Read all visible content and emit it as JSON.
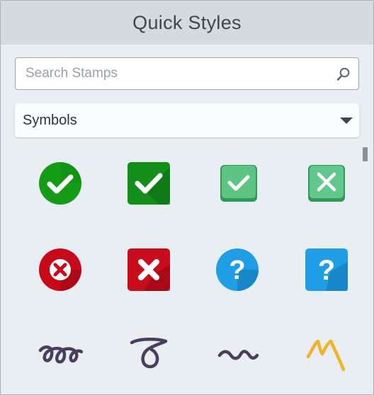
{
  "panel": {
    "title": "Quick Styles"
  },
  "search": {
    "placeholder": "Search Stamps",
    "value": "",
    "icon": "search-icon"
  },
  "category_dropdown": {
    "selected": "Symbols",
    "icon": "chevron-down-icon"
  },
  "stamps": [
    {
      "icon": "green-circle-checkmark-icon",
      "color": "#149c16"
    },
    {
      "icon": "green-square-checkmark-icon",
      "color": "#14901a"
    },
    {
      "icon": "green-soft-checkmark-icon",
      "color": "#48b26e"
    },
    {
      "icon": "green-soft-x-icon",
      "color": "#4fb476"
    },
    {
      "icon": "red-circle-x-icon",
      "color": "#c8091a"
    },
    {
      "icon": "red-square-x-icon",
      "color": "#c80c1c"
    },
    {
      "icon": "blue-circle-question-icon",
      "color": "#1f9ee6"
    },
    {
      "icon": "blue-square-question-icon",
      "color": "#1f9ee6"
    },
    {
      "icon": "double-loop-squiggle-icon",
      "color": "#4a3d5e"
    },
    {
      "icon": "single-loop-squiggle-icon",
      "color": "#4a3d5e"
    },
    {
      "icon": "wavy-line-icon",
      "color": "#4a3d5e"
    },
    {
      "icon": "zigzag-line-icon",
      "color": "#f0b429"
    }
  ]
}
